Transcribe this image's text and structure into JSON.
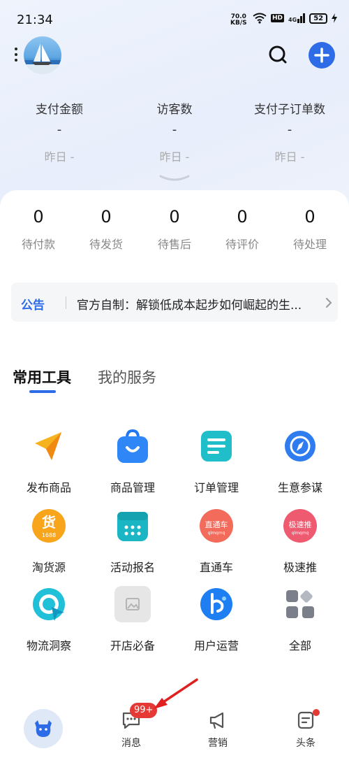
{
  "status_bar": {
    "time": "21:34",
    "net_speed": "70.0",
    "net_unit": "KB/S",
    "hd": "HD",
    "signal": "4G",
    "battery": "52"
  },
  "header": {
    "avatar_icon": "avatar-sailboat-icon",
    "search_icon": "search-icon",
    "add_icon": "plus-icon",
    "accent_color": "#2e6be6"
  },
  "stats": [
    {
      "label": "支付金额",
      "value": "-",
      "yesterday": "昨日 -"
    },
    {
      "label": "访客数",
      "value": "-",
      "yesterday": "昨日 -"
    },
    {
      "label": "支付子订单数",
      "value": "-",
      "yesterday": "昨日 -"
    }
  ],
  "orders": [
    {
      "count": "0",
      "label": "待付款"
    },
    {
      "count": "0",
      "label": "待发货"
    },
    {
      "count": "0",
      "label": "待售后"
    },
    {
      "count": "0",
      "label": "待评价"
    },
    {
      "count": "0",
      "label": "待处理"
    }
  ],
  "notice": {
    "tag": "公告",
    "text": "官方自制：解锁低成本起步如何崛起的生..."
  },
  "tabs": [
    {
      "label": "常用工具",
      "active": true
    },
    {
      "label": "我的服务",
      "active": false
    }
  ],
  "tools": [
    {
      "label": "发布商品",
      "icon": "paper-plane-icon"
    },
    {
      "label": "商品管理",
      "icon": "shopping-bag-icon"
    },
    {
      "label": "订单管理",
      "icon": "order-list-icon"
    },
    {
      "label": "生意参谋",
      "icon": "compass-icon"
    },
    {
      "label": "淘货源",
      "icon": "source-goods-icon",
      "icon_text": "货",
      "icon_sub": "1688"
    },
    {
      "label": "活动报名",
      "icon": "calendar-grid-icon"
    },
    {
      "label": "直通车",
      "icon": "ztc-icon",
      "icon_text": "直通车",
      "icon_sub": "qlmqmq"
    },
    {
      "label": "极速推",
      "icon": "jisutui-icon",
      "icon_text": "极速推",
      "icon_sub": "qlmqmq"
    },
    {
      "label": "物流洞察",
      "icon": "logistics-icon"
    },
    {
      "label": "开店必备",
      "icon": "image-placeholder-icon"
    },
    {
      "label": "用户运营",
      "icon": "user-ops-icon"
    },
    {
      "label": "全部",
      "icon": "all-grid-icon"
    }
  ],
  "bottom_nav": {
    "items": [
      {
        "label": "",
        "icon": "home-cow-icon"
      },
      {
        "label": "消息",
        "icon": "message-icon"
      },
      {
        "label": "营销",
        "icon": "megaphone-icon"
      },
      {
        "label": "头条",
        "icon": "news-icon"
      }
    ],
    "message_badge": "99+"
  }
}
